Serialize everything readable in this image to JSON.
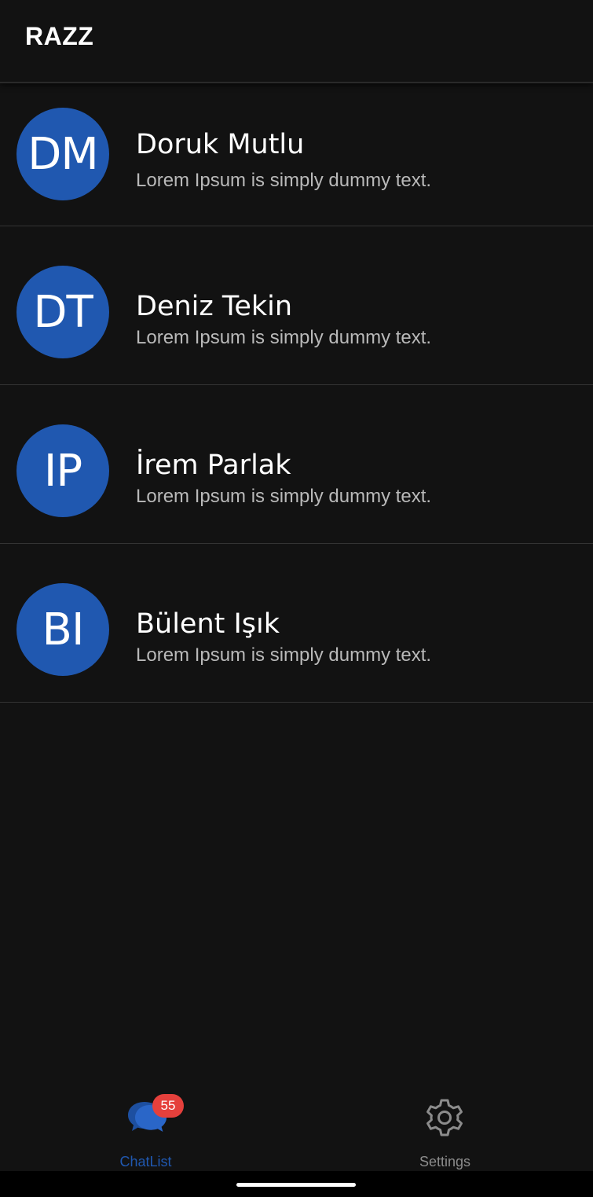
{
  "app": {
    "title": "RAZZ"
  },
  "chats": [
    {
      "initials": "DM",
      "name": "Doruk Mutlu",
      "preview": "Lorem Ipsum is simply dummy text."
    },
    {
      "initials": "DT",
      "name": "Deniz Tekin",
      "preview": "Lorem Ipsum is simply dummy text."
    },
    {
      "initials": "IP",
      "name": "İrem Parlak",
      "preview": "Lorem Ipsum is simply dummy text."
    },
    {
      "initials": "BI",
      "name": "Bülent Işık",
      "preview": "Lorem Ipsum is simply dummy text."
    }
  ],
  "nav": {
    "chatlist": {
      "label": "ChatList",
      "badge": "55",
      "icon": "chat-bubbles-icon"
    },
    "settings": {
      "label": "Settings",
      "icon": "gear-icon"
    }
  },
  "colors": {
    "background": "#121212",
    "accent": "#2058b0",
    "badge": "#e5403c",
    "inactive": "#8c8c8c"
  }
}
